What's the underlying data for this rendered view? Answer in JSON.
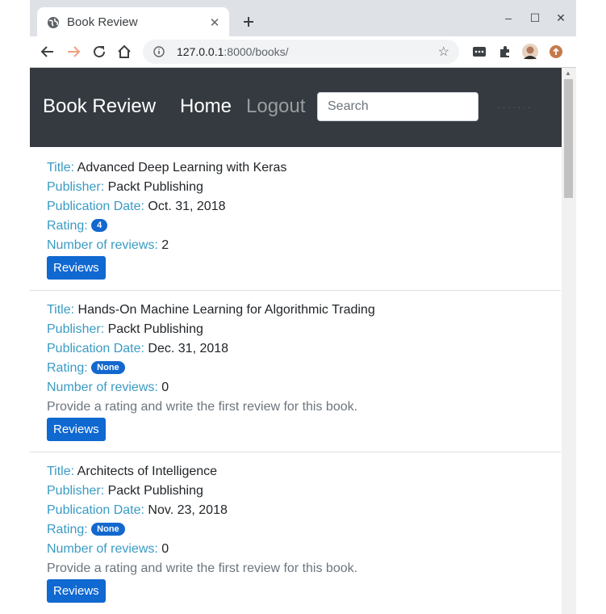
{
  "browser": {
    "tab_title": "Book Review",
    "new_tab_icon": "plus-icon",
    "url_host": "127.0.0.1",
    "url_rest": ":8000/books/",
    "win_min": "–",
    "win_max": "☐",
    "win_close": "✕"
  },
  "navbar": {
    "brand": "Book Review",
    "home": "Home",
    "logout": "Logout",
    "search_placeholder": "Search",
    "dots": "· · · · · · ·"
  },
  "books": [
    {
      "title_label": "Title:",
      "title": "Advanced Deep Learning with Keras",
      "publisher_label": "Publisher:",
      "publisher": "Packt Publishing",
      "date_label": "Publication Date:",
      "date": "Oct. 31, 2018",
      "rating_label": "Rating:",
      "rating": "4",
      "reviews_label": "Number of reviews:",
      "reviews": "2",
      "message": "",
      "button": "Reviews"
    },
    {
      "title_label": "Title:",
      "title": "Hands-On Machine Learning for Algorithmic Trading",
      "publisher_label": "Publisher:",
      "publisher": "Packt Publishing",
      "date_label": "Publication Date:",
      "date": "Dec. 31, 2018",
      "rating_label": "Rating:",
      "rating": "None",
      "reviews_label": "Number of reviews:",
      "reviews": "0",
      "message": "Provide a rating and write the first review for this book.",
      "button": "Reviews"
    },
    {
      "title_label": "Title:",
      "title": "Architects of Intelligence",
      "publisher_label": "Publisher:",
      "publisher": "Packt Publishing",
      "date_label": "Publication Date:",
      "date": "Nov. 23, 2018",
      "rating_label": "Rating:",
      "rating": "None",
      "reviews_label": "Number of reviews:",
      "reviews": "0",
      "message": "Provide a rating and write the first review for this book.",
      "button": "Reviews"
    }
  ],
  "colors": {
    "navbar_bg": "#343a40",
    "label": "#3a9bc4",
    "button": "#1068d1",
    "badge": "#1368ce"
  }
}
